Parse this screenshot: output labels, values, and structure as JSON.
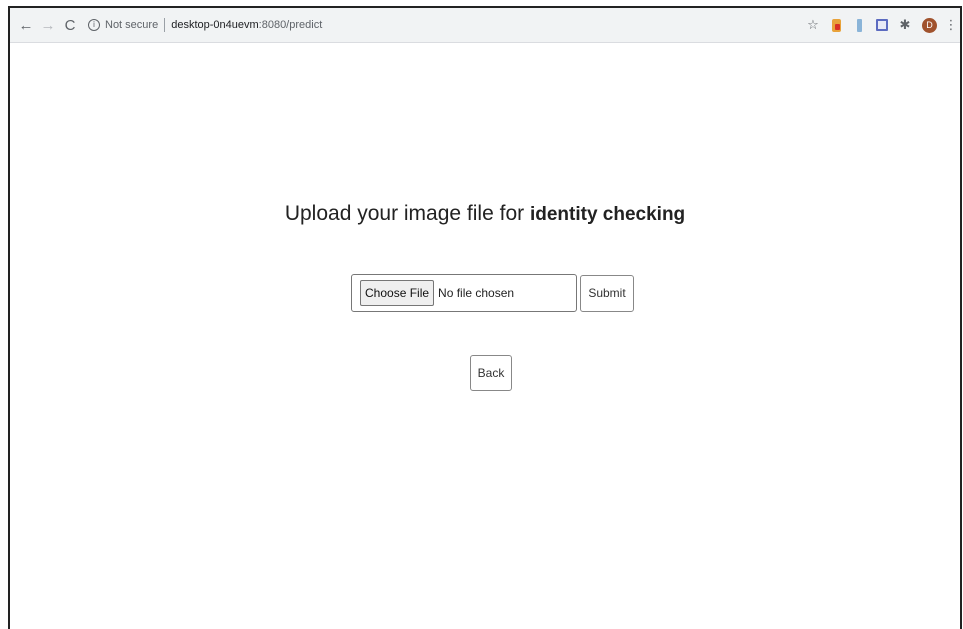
{
  "browser": {
    "back_glyph": "←",
    "forward_glyph": "→",
    "reload_glyph": "C",
    "security_label": "Not secure",
    "url_host": "desktop-0n4uevm",
    "url_path": ":8080/predict",
    "toolbar_icons": [
      "star-icon",
      "extension-icon",
      "extension-icon",
      "save-icon",
      "puzzle-icon",
      "avatar",
      "menu-icon"
    ],
    "avatar_letter": "D"
  },
  "page": {
    "heading_regular": "Upload your image file for ",
    "heading_bold": "identity checking",
    "choose_file_label": "Choose File",
    "file_status": "No file chosen",
    "submit_label": "Submit",
    "back_label": "Back"
  }
}
